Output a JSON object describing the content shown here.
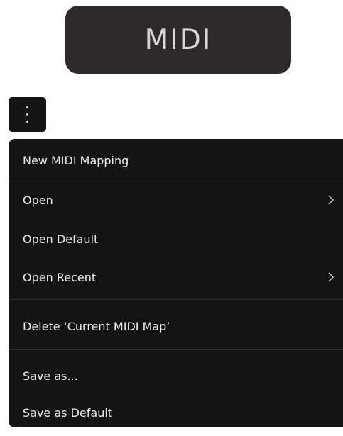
{
  "title": "MIDI",
  "kebab_icon": "more-vertical-icon",
  "menu": {
    "new_mapping": "New MIDI Mapping",
    "open": "Open",
    "open_default": "Open Default",
    "open_recent": "Open Recent",
    "delete_current": "Delete ‘Current MIDI Map’",
    "save_as": "Save as...",
    "save_as_default": "Save as Default",
    "submenu_icon": "chevron-right-icon"
  },
  "colors": {
    "title_bg": "#2e2a2a",
    "menu_bg": "#151414",
    "text": "#ececec"
  }
}
